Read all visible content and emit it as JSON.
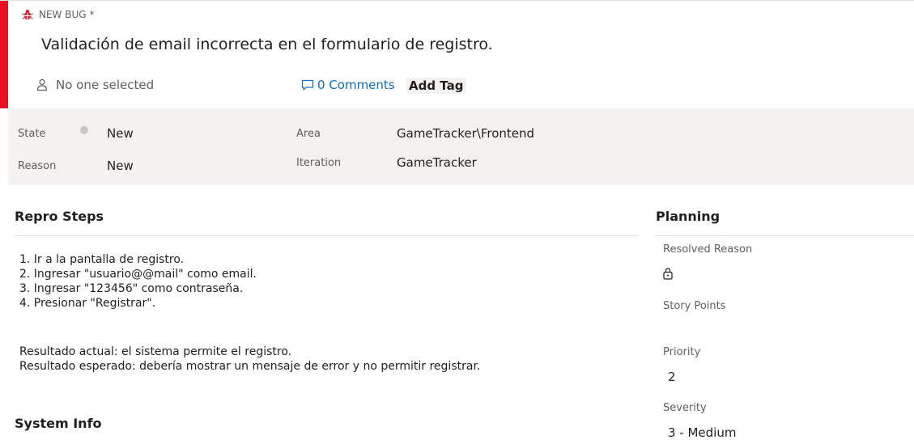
{
  "header": {
    "work_item_type": "NEW BUG *",
    "title": "Validación de email incorrecta en el formulario de registro.",
    "assignee": "No one selected",
    "comments": "0 Comments",
    "add_tag": "Add Tag",
    "bug_icon": "bug-icon",
    "accent_color": "#e81123"
  },
  "fields": {
    "state_label": "State",
    "state_value": "New",
    "reason_label": "Reason",
    "reason_value": "New",
    "area_label": "Area",
    "area_value": "GameTracker\\Frontend",
    "iteration_label": "Iteration",
    "iteration_value": "GameTracker"
  },
  "repro": {
    "title": "Repro Steps",
    "steps": [
      "1. Ir a la pantalla de registro.",
      "2. Ingresar \"usuario@@mail\" como email.",
      "3. Ingresar \"123456\" como contraseña.",
      "4. Presionar \"Registrar\"."
    ],
    "actual": "Resultado actual: el sistema permite el registro.",
    "expected": "Resultado esperado: debería mostrar un mensaje de error y no permitir registrar."
  },
  "system_info": {
    "title": "System Info"
  },
  "planning": {
    "title": "Planning",
    "resolved_reason_label": "Resolved Reason",
    "story_points_label": "Story Points",
    "priority_label": "Priority",
    "priority_value": "2",
    "severity_label": "Severity",
    "severity_value": "3 - Medium"
  }
}
